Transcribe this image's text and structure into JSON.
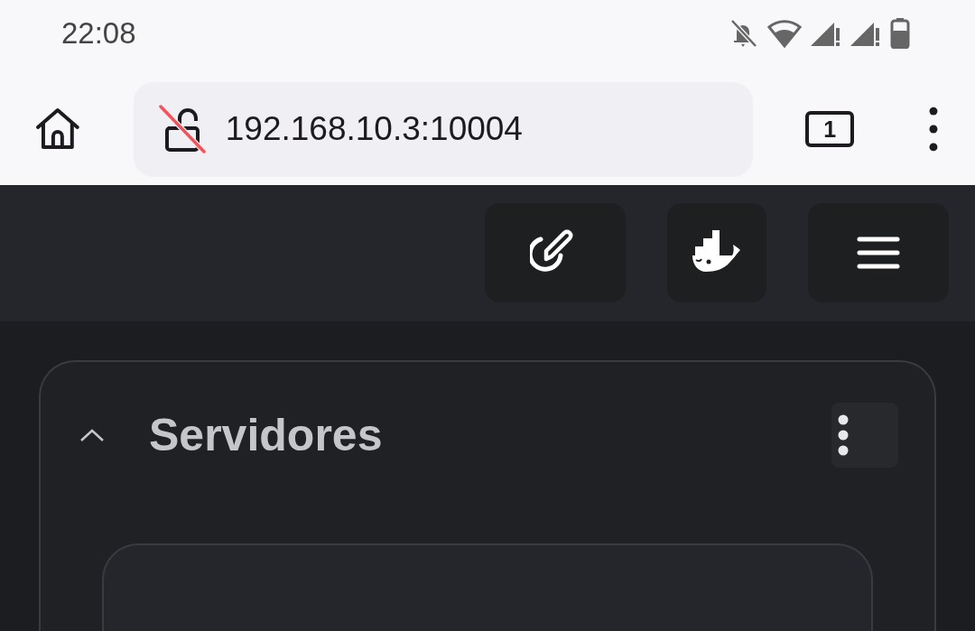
{
  "status_bar": {
    "time": "22:08"
  },
  "browser": {
    "url": "192.168.10.3:10004",
    "tab_count": "1"
  },
  "header": {
    "buttons": [
      {
        "kind": "edit"
      },
      {
        "kind": "docker"
      },
      {
        "kind": "menu"
      }
    ]
  },
  "section": {
    "title": "Servidores",
    "expanded": true
  }
}
